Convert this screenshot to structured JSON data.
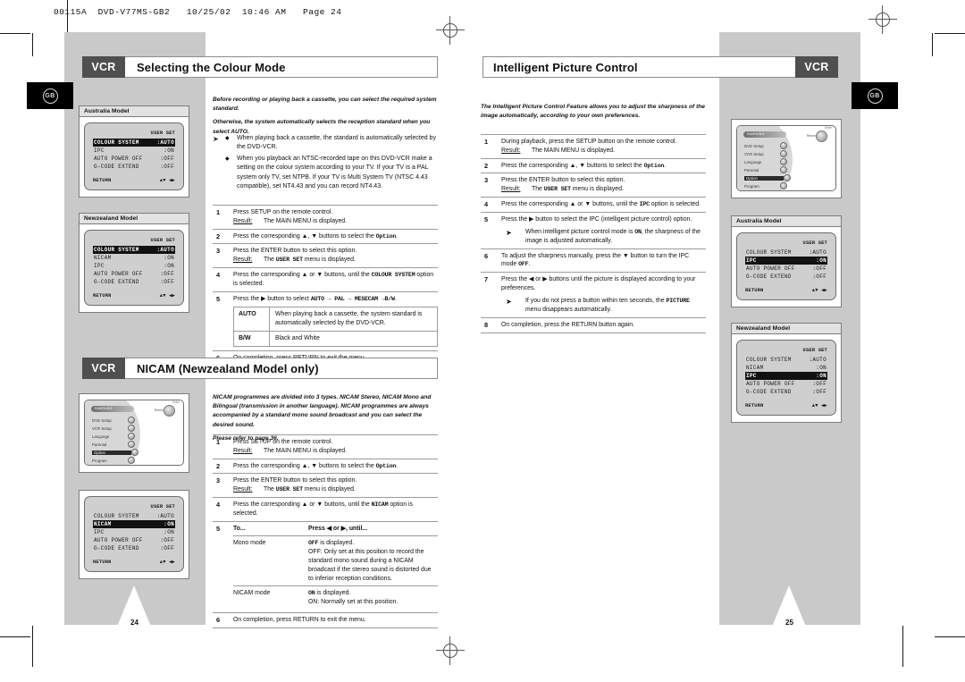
{
  "meta": {
    "filestamp": "00115A  DVD-V77MS-GB2   10/25/02  10:46 AM   Page 24",
    "region_badge": "GB",
    "vcr_tag": "VCR",
    "page_left": "24",
    "page_right": "25"
  },
  "left_page": {
    "section1": {
      "tag": "VCR",
      "title": "Selecting the Colour Mode",
      "intro": [
        "Before recording or playing back a cassette, you can select the required system standard.",
        "Otherwise, the system automatically selects the reception standard when you select AUTO."
      ],
      "bullets": [
        "When playing back a cassette, the standard is automatically selected by the DVD-VCR.",
        "When you playback an NTSC-recorded tape on this DVD-VCR make a setting on the colour system according to your TV.  If your TV is a  PAL system only TV, set NTPB. If your TV is Multi System TV (NTSC 4.43 compatible), set NT4.43 and you can record NT4.43."
      ],
      "steps": [
        {
          "num": "1",
          "text": "Press SETUP on the remote control.",
          "result_label": "Result:",
          "result_text": "The MAIN MENU is displayed."
        },
        {
          "num": "2",
          "text_pre": "Press the corresponding ▲, ▼ buttons to select the ",
          "mono": "Option",
          "text_post": "."
        },
        {
          "num": "3",
          "text": "Press the ENTER button to select this option.",
          "result_label": "Result:",
          "result_pre": "The ",
          "result_mono": "USER SET",
          "result_post": " menu is displayed."
        },
        {
          "num": "4",
          "text_pre": "Press the corresponding ▲ or ▼ buttons, until the  ",
          "mono": "COLOUR SYSTEM",
          "text_post": " option is selected."
        },
        {
          "num": "5",
          "text_pre": "Press the ▶ button to select ",
          "mono": "AUTO → PAL → MESECAM →B/W",
          "text_post": ".",
          "subtable": [
            {
              "key": "AUTO",
              "value": "When playing back a cassette, the system standard is automatically selected by the DVD-VCR."
            },
            {
              "key": "B/W",
              "value": "Black and White"
            }
          ]
        },
        {
          "num": "6",
          "text": "On completion, press RETURN to exit the menu."
        }
      ],
      "captures": [
        {
          "label": "Australia Model",
          "userset": "USER SET",
          "rows": [
            {
              "k": "COLOUR SYSTEM",
              "v": ":AUTO",
              "highlight": true
            },
            {
              "k": "IPC",
              "v": ":ON",
              "highlight": false
            },
            {
              "k": "AUTO POWER OFF",
              "v": ":OFF",
              "highlight": false
            },
            {
              "k": "G-CODE EXTEND",
              "v": ":OFF",
              "highlight": false
            }
          ],
          "footer_left": "RETURN",
          "footer_right": "▲▼ ◀▶"
        },
        {
          "label": "Newzealand Model",
          "userset": "USER SET",
          "rows": [
            {
              "k": "COLOUR SYSTEM",
              "v": ":AUTO",
              "highlight": true
            },
            {
              "k": "NICAM",
              "v": ":ON",
              "highlight": false
            },
            {
              "k": "IPC",
              "v": ":ON",
              "highlight": false
            },
            {
              "k": "AUTO POWER OFF",
              "v": ":OFF",
              "highlight": false
            },
            {
              "k": "G-CODE EXTEND",
              "v": ":OFF",
              "highlight": false
            }
          ],
          "footer_left": "RETURN",
          "footer_right": "▲▼ ◀▶"
        }
      ]
    },
    "section2": {
      "tag": "VCR",
      "title": "NICAM (Newzealand Model only)",
      "intro": [
        "NICAM programmes are divided into 3 types. NICAM Stereo, NICAM Mono and Bilingual (transmission in another language). NICAM programmes are always accompanied by a standard mono sound broadcast and you can select the desired sound.",
        "Please refer to page 36."
      ],
      "steps": [
        {
          "num": "1",
          "text": "Press SETUP on the remote control.",
          "result_label": "Result:",
          "result_text": "The MAIN MENU is displayed."
        },
        {
          "num": "2",
          "text_pre": "Press the corresponding ▲, ▼ buttons to select the ",
          "mono": "Option",
          "text_post": "."
        },
        {
          "num": "3",
          "text": "Press the ENTER button to select this option.",
          "result_label": "Result:",
          "result_pre": "The ",
          "result_mono": "USER SET",
          "result_post": " menu is displayed."
        },
        {
          "num": "4",
          "text_pre": "Press the corresponding ▲ or ▼ buttons, until the ",
          "mono": "NICAM",
          "text_post": " option is selected."
        },
        {
          "num": "5",
          "col_head_a": "To...",
          "col_head_b": "Press ◀ or ▶, until...",
          "rows": [
            {
              "a": "Mono mode",
              "b_mono": "OFF",
              "b_rest": " is displayed.",
              "b_more": "OFF: Only set at this position to record the standard  mono sound during a NICAM broadcast if the stereo sound is distorted due to inferior reception conditions."
            },
            {
              "a": "NICAM mode",
              "b_mono": "ON",
              "b_rest": " is displayed.",
              "b_more": "ON: Normally set at this position."
            }
          ]
        },
        {
          "num": "6",
          "text": "On completion, press RETURN to exit the menu."
        }
      ],
      "menu_capture": {
        "brand": "SAMSUNG",
        "dial_label": "Return",
        "dial_label2": "Enter",
        "items": [
          {
            "label": "DVD Setup",
            "selected": false
          },
          {
            "label": "VCR Setup",
            "selected": false
          },
          {
            "label": "Language",
            "selected": false
          },
          {
            "label": "Parental",
            "selected": false
          },
          {
            "label": "Option",
            "selected": true
          },
          {
            "label": "Program",
            "selected": false
          }
        ]
      },
      "capture": {
        "userset": "USER SET",
        "rows": [
          {
            "k": "COLOUR SYSTEM",
            "v": ":AUTO",
            "highlight": false
          },
          {
            "k": "NICAM",
            "v": ":ON",
            "highlight": true
          },
          {
            "k": "IPC",
            "v": ":ON",
            "highlight": false
          },
          {
            "k": "AUTO POWER OFF",
            "v": ":OFF",
            "highlight": false
          },
          {
            "k": "G-CODE EXTEND",
            "v": ":OFF",
            "highlight": false
          }
        ],
        "footer_left": "RETURN",
        "footer_right": "▲▼ ◀▶"
      }
    }
  },
  "right_page": {
    "section": {
      "tag": "VCR",
      "title": "Intelligent Picture Control",
      "intro": [
        "The Intelligent Picture Control Feature allows you to adjust the sharpness of the image automatically, according to your own preferences."
      ],
      "steps": [
        {
          "num": "1",
          "text": "During playback, press the SETUP button on the remote control.",
          "result_label": "Result:",
          "result_text": "The MAIN MENU is displayed."
        },
        {
          "num": "2",
          "text_pre": "Press the corresponding ▲, ▼ buttons to select the ",
          "mono": "Option",
          "text_post": "."
        },
        {
          "num": "3",
          "text": "Press the ENTER button to select this option.",
          "result_label": "Result:",
          "result_pre": "The ",
          "result_mono": "USER SET",
          "result_post": " menu is displayed."
        },
        {
          "num": "4",
          "text_pre": "Press the corresponding ▲ or ▼ buttons, until the  ",
          "mono": "IPC",
          "text_post": " option is selected."
        },
        {
          "num": "5",
          "text": "Press the ▶ button to select the IPC (intelligent picture control) option.",
          "note_pre": "When intelligent picture control mode is ",
          "note_mono": "ON",
          "note_post": ", the sharpness of the image is adjusted automatically."
        },
        {
          "num": "6",
          "text_pre": "To adjust the sharpness manually, press the ▼ button to turn the IPC mode ",
          "mono": "OFF",
          "text_post": "."
        },
        {
          "num": "7",
          "text": "Press the ◀ or ▶ buttons until the picture is displayed according to your preferences.",
          "note_pre": "If you do not press a button within ten seconds, the ",
          "note_mono": "PICTURE",
          "note_post": " menu disappears automatically."
        },
        {
          "num": "8",
          "text": "On completion, press the RETURN button again."
        }
      ],
      "menu_capture": {
        "brand": "SAMSUNG",
        "dial_label": "Return",
        "dial_label2": "Enter",
        "items": [
          {
            "label": "DVD Setup",
            "selected": false
          },
          {
            "label": "VCR Setup",
            "selected": false
          },
          {
            "label": "Language",
            "selected": false
          },
          {
            "label": "Parental",
            "selected": false
          },
          {
            "label": "Option",
            "selected": true
          },
          {
            "label": "Program",
            "selected": false
          }
        ]
      },
      "captures": [
        {
          "label": "Australia Model",
          "userset": "USER SET",
          "rows": [
            {
              "k": "COLOUR SYSTEM",
              "v": ":AUTO",
              "highlight": false
            },
            {
              "k": "IPC",
              "v": ":ON",
              "highlight": true
            },
            {
              "k": "AUTO POWER OFF",
              "v": ":OFF",
              "highlight": false
            },
            {
              "k": "G-CODE EXTEND",
              "v": ":OFF",
              "highlight": false
            }
          ],
          "footer_left": "RETURN",
          "footer_right": "▲▼ ◀▶"
        },
        {
          "label": "Newzealand Model",
          "userset": "USER SET",
          "rows": [
            {
              "k": "COLOUR SYSTEM",
              "v": ":AUTO",
              "highlight": false
            },
            {
              "k": "NICAM",
              "v": ":ON",
              "highlight": false
            },
            {
              "k": "IPC",
              "v": ":ON",
              "highlight": true
            },
            {
              "k": "AUTO POWER OFF",
              "v": ":OFF",
              "highlight": false
            },
            {
              "k": "G-CODE EXTEND",
              "v": ":OFF",
              "highlight": false
            }
          ],
          "footer_left": "RETURN",
          "footer_right": "▲▼ ◀▶"
        }
      ]
    }
  }
}
